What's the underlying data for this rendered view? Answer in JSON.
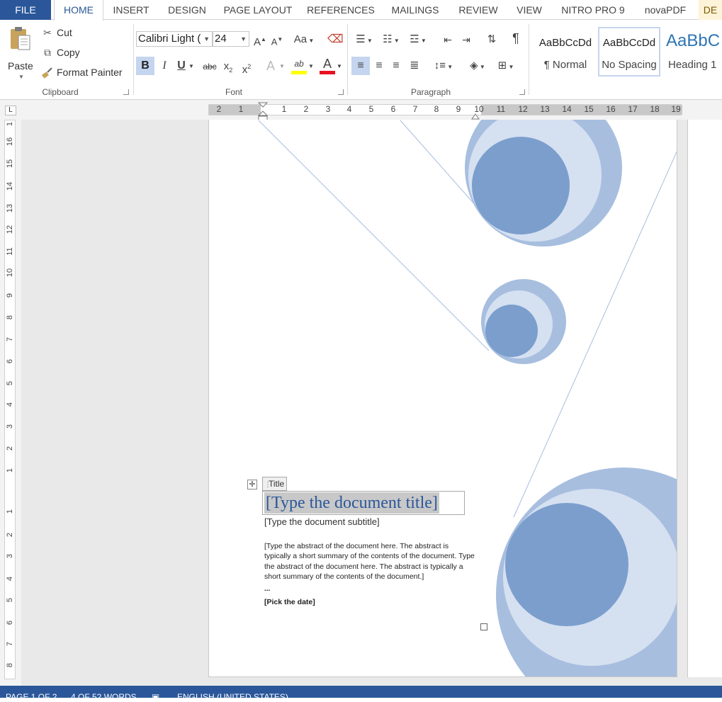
{
  "tabs": {
    "file": "FILE",
    "home": "HOME",
    "insert": "INSERT",
    "design": "DESIGN",
    "page_layout": "PAGE LAYOUT",
    "references": "REFERENCES",
    "mailings": "MAILINGS",
    "review": "REVIEW",
    "view": "VIEW",
    "nitro": "NITRO PRO 9",
    "novapdf": "novaPDF",
    "de": "DE"
  },
  "clipboard": {
    "label": "Clipboard",
    "paste": "Paste",
    "cut": "Cut",
    "copy": "Copy",
    "format_painter": "Format Painter"
  },
  "font": {
    "label": "Font",
    "name": "Calibri Light (",
    "size": "24",
    "grow": "A",
    "shrink": "A",
    "change_case": "Aa",
    "bold": "B",
    "italic": "I",
    "underline": "U",
    "strike": "abc",
    "subscript": "x",
    "superscript": "x",
    "text_effects": "A",
    "highlight": "ab",
    "font_color": "A",
    "highlight_color": "#ffff00",
    "font_color_value": "#e81123"
  },
  "paragraph": {
    "label": "Paragraph",
    "pilcrow": "¶"
  },
  "styles": {
    "items": [
      {
        "sample": "AaBbCcDd",
        "name": "¶ Normal"
      },
      {
        "sample": "AaBbCcDd",
        "name": "No Spacing"
      },
      {
        "sample": "AaBbC",
        "name": "Heading 1"
      }
    ]
  },
  "ruler": {
    "corner": "L",
    "numbers": [
      "2",
      "1",
      "1",
      "2",
      "3",
      "4",
      "5",
      "6",
      "7",
      "8",
      "9",
      "10",
      "11",
      "12",
      "13",
      "14",
      "15",
      "16",
      "17",
      "18",
      "19"
    ],
    "vertical_numbers": [
      "1",
      "16",
      "15",
      "14",
      "13",
      "12",
      "11",
      "10",
      "9",
      "8",
      "7",
      "6",
      "5",
      "4",
      "3",
      "2",
      "1",
      "1",
      "2",
      "3",
      "4",
      "5",
      "6",
      "7",
      "8"
    ]
  },
  "document": {
    "title_tag": "Title",
    "title": "[Type the document title]",
    "subtitle": "[Type the document subtitle]",
    "abstract": "[Type the abstract of the document here. The abstract is typically a short summary of the contents of the document. Type the abstract of the document here. The abstract is typically a short summary of the contents of the document.]",
    "dots": "...",
    "date": "[Pick the date]"
  },
  "status": {
    "page": "PAGE 1 OF 2",
    "words": "4 OF 52 WORDS",
    "language": "ENGLISH (UNITED STATES)"
  },
  "colors": {
    "accent": "#2b579a",
    "circle_light": "#d5e0f1",
    "circle_mid": "#a7bedf",
    "circle_dark": "#7b9ecd"
  }
}
